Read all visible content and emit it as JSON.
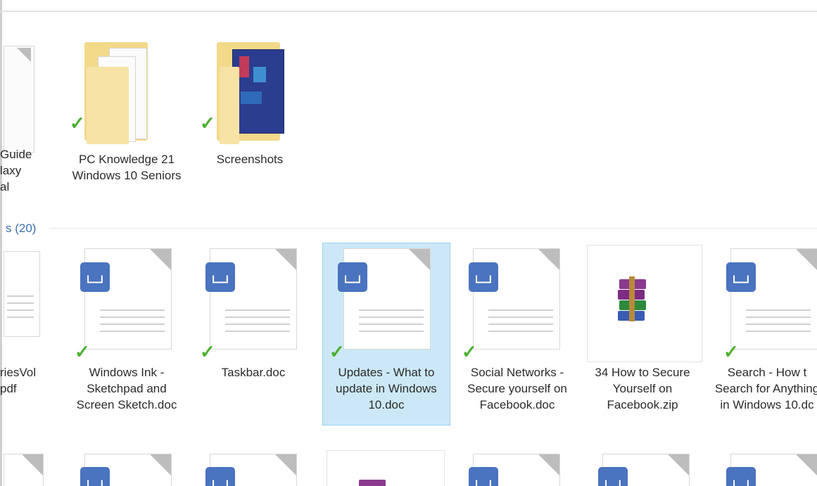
{
  "folders": [
    {
      "label": "Guide\nlaxy\nal",
      "synced": true
    },
    {
      "label": "PC Knowledge 21 Windows 10 Seniors",
      "synced": true
    },
    {
      "label": "Screenshots",
      "synced": true
    }
  ],
  "files_group": {
    "header": "s (20)"
  },
  "files_row1": [
    {
      "label": "riesVol\npdf",
      "type": "pdf"
    },
    {
      "label": "Windows Ink - Sketchpad and Screen Sketch.doc",
      "type": "doc",
      "synced": true
    },
    {
      "label": "Taskbar.doc",
      "type": "doc",
      "synced": true
    },
    {
      "label": "Updates - What to update in Windows 10.doc",
      "type": "doc",
      "synced": true,
      "selected": true
    },
    {
      "label": "Social Networks - Secure yourself on Facebook.doc",
      "type": "doc",
      "synced": true
    },
    {
      "label": "34 How to Secure Yourself on Facebook.zip",
      "type": "zip"
    },
    {
      "label": "Search - How t Search for Anything in Windows 10.dc",
      "type": "doc",
      "synced": true
    }
  ],
  "icons": {
    "doc": "wps-document-icon",
    "zip": "winrar-archive-icon",
    "folder": "folder-icon",
    "check": "sync-check-icon"
  },
  "colors": {
    "selection_bg": "#cce8f6",
    "selection_border": "#99d1ef",
    "wps_blue": "#4a73c0",
    "check_green": "#4caf2f",
    "group_header": "#3d6fb0"
  }
}
